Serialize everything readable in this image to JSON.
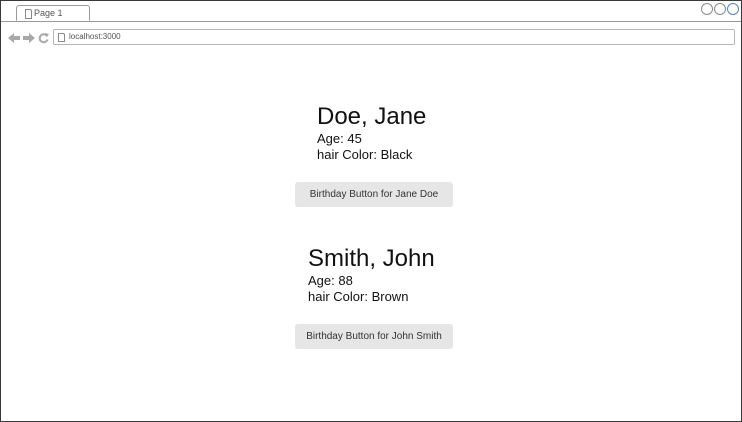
{
  "browser": {
    "tab_title": "Page 1",
    "url": "localhost:3000"
  },
  "people": [
    {
      "name": "Doe, Jane",
      "age_line": "Age: 45",
      "hair_line": "hair Color: Black",
      "button_label": "Birthday Button for Jane Doe"
    },
    {
      "name": "Smith, John",
      "age_line": "Age: 88",
      "hair_line": "hair Color: Brown",
      "button_label": "Birthday Button for John Smith"
    }
  ],
  "colors": {
    "button_bg": "#e6e6e6",
    "window_control_accent": "#4a86c8"
  }
}
